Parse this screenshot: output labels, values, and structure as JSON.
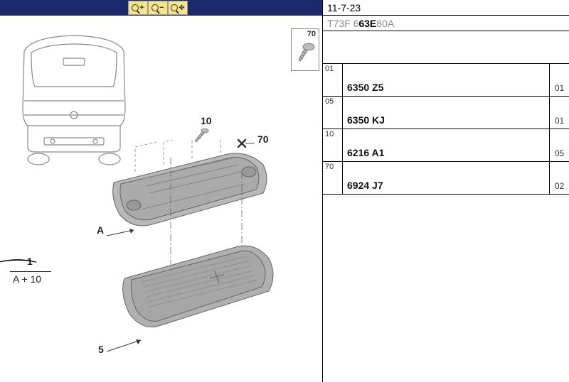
{
  "header": {
    "date": "11-7-23",
    "code_pre": "T73F 6 ",
    "code_bold": "63E",
    "code_post": " 80A"
  },
  "callout": {
    "num": "70"
  },
  "diagram_labels": {
    "l10": "10",
    "l70": "70",
    "lA": "A",
    "l5": "5",
    "frac_top": "1",
    "frac_bot": "A + 10"
  },
  "parts": [
    {
      "idx": "01",
      "num": "6350 Z5",
      "qty": "01"
    },
    {
      "idx": "05",
      "num": "6350 KJ",
      "qty": "01"
    },
    {
      "idx": "10",
      "num": "6216 A1",
      "qty": "05"
    },
    {
      "idx": "70",
      "num": "6924 J7",
      "qty": "02"
    }
  ]
}
